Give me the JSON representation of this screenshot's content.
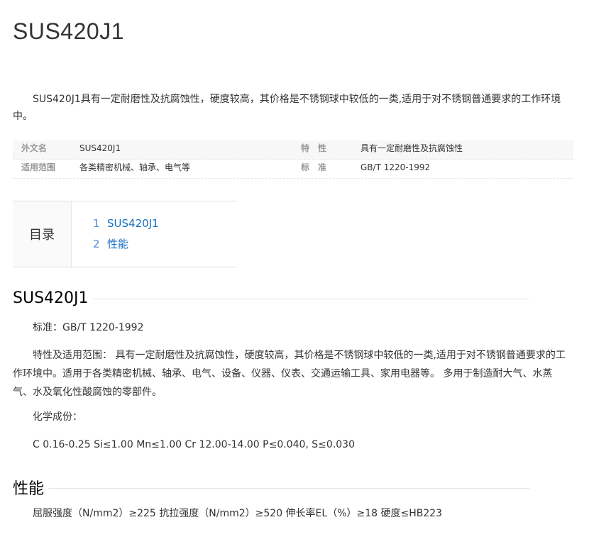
{
  "title": "SUS420J1",
  "summary": "SUS420J1具有一定耐磨性及抗腐蚀性，硬度较高，其价格是不锈钢球中较低的一类,适用于对不锈钢普通要求的工作环境中。",
  "basic_info": {
    "rows": [
      {
        "name1": "外文名",
        "value1": "SUS420J1",
        "name2": "特　性",
        "value2": "具有一定耐磨性及抗腐蚀性"
      },
      {
        "name1": "适用范围",
        "value1": "各类精密机械、轴承、电气等",
        "name2": "标　准",
        "value2": "GB/T 1220-1992"
      }
    ]
  },
  "toc": {
    "title": "目录",
    "items": [
      {
        "num": "1",
        "label": "SUS420J1"
      },
      {
        "num": "2",
        "label": "性能"
      }
    ]
  },
  "sections": [
    {
      "heading": "SUS420J1",
      "paragraphs": [
        "标准：GB/T 1220-1992",
        "特性及适用范围： 具有一定耐磨性及抗腐蚀性，硬度较高，其价格是不锈钢球中较低的一类,适用于对不锈钢普通要求的工作环境中。适用于各类精密机械、轴承、电气、设备、仪器、仪表、交通运输工具、家用电器等。 多用于制造耐大气、水蒸气、水及氧化性酸腐蚀的零部件。",
        "化学成份：",
        "C 0.16-0.25 Si≤1.00 Mn≤1.00 Cr 12.00-14.00 P≤0.040, S≤0.030"
      ]
    },
    {
      "heading": "性能",
      "paragraphs": [
        "屈服强度（N/mm2）≥225 抗拉强度（N/mm2）≥520 伸长率EL（%）≥18 硬度≤HB223"
      ]
    }
  ]
}
